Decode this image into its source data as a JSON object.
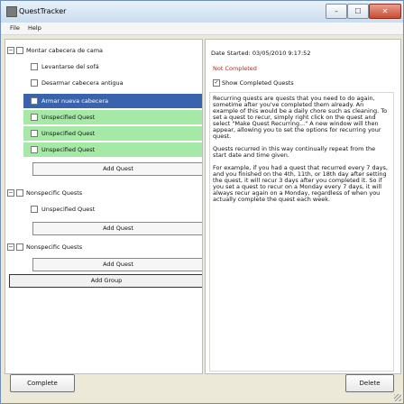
{
  "window": {
    "title": "QuestTracker",
    "minimize": "–",
    "maximize": "☐",
    "close": "✕"
  },
  "menu": [
    "File",
    "Help"
  ],
  "groups": [
    {
      "toggle": "−",
      "label": "Montar cabecera de cama",
      "quests": [
        {
          "label": "Levantarse del sofá"
        },
        {
          "label": "Desarmar cabecera antigua"
        },
        {
          "label": "Armar nueva cabecera"
        },
        {
          "label": "Unspecified Quest"
        },
        {
          "label": "Unspecified Quest"
        },
        {
          "label": "Unspecified Quest"
        }
      ],
      "add": "Add Quest"
    },
    {
      "toggle": "−",
      "label": "Nonspecific Quests",
      "quests": [
        {
          "label": "Unspecified Quest"
        }
      ],
      "add": "Add Quest"
    },
    {
      "toggle": "−",
      "label": "Nonspecific Quests",
      "quests": [],
      "add": "Add Quest"
    }
  ],
  "add_group": "Add Group",
  "details": {
    "date_started": "Date Started: 03/05/2010 9:17:52",
    "status": "Not Completed",
    "show_completed_check": "✓",
    "show_completed": "Show Completed Quests",
    "description": "Recurring quests are quests that you need to do again, sometime after you've completed them already. An example of this would be a daily chore such as cleaning. To set a quest to recur, simply right click on the quest and select \"Make Quest Recurring...\" A new window will then appear, allowing you to set the options for recurring your quest.\n\nQuests recurred in this way continually repeat from the start date and time given.\n\nFor example, if you had a quest that recurred every 7 days, and you finished on the 4th, 11th, or 18th day after setting the quest, it will recur 3 days after you completed it. So if you set a quest to recur on a Monday every 7 days, it will always recur again on a Monday, regardless of when you actually complete the quest each week."
  },
  "buttons": {
    "complete": "Complete",
    "delete": "Delete"
  },
  "colors": {
    "selected": "#3a63ad",
    "unspecified": "#a6e9a6",
    "not_completed": "#d01b1b"
  }
}
